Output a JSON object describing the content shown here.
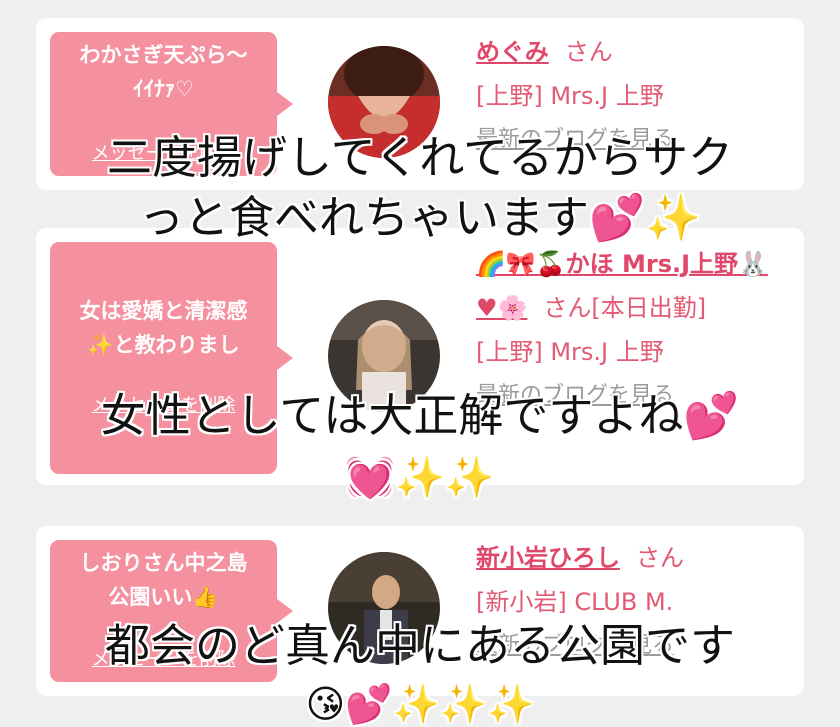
{
  "cards": [
    {
      "bubble_text": "わかさぎ天ぷら〜\nｲｲﾅｧ♡",
      "delete_label": "メッセージを削除",
      "name": "めぐみ",
      "honorific": "さん",
      "area": "[上野] Mrs.J 上野",
      "blog_link": "最新のブログを見る"
    },
    {
      "bubble_text": "女は愛嬌と清潔感\n✨と教わりまし",
      "delete_label": "メッセージを削除",
      "name": "🌈🎀🍒かほ Mrs.J上野🐰♥🌸",
      "honorific": "さん[本日出勤]",
      "area": "[上野] Mrs.J 上野",
      "blog_link": "最新のブログを見る"
    },
    {
      "bubble_text": "しおりさん中之島\n公園いい👍",
      "delete_label": "メッセージを削除",
      "name": "新小岩ひろし",
      "honorific": "さん",
      "area": "[新小岩] CLUB M.",
      "blog_link": "最新のブログを見る"
    }
  ],
  "captions": {
    "line1": "二度揚げしてくれてるからサク",
    "line2": "っと食べれちゃいます💕✨",
    "line3": "女性としては大正解ですよね💕",
    "line4": "💓✨✨",
    "line5": "都会のど真ん中にある公園です",
    "line6": "😘💕✨✨✨"
  },
  "colors": {
    "bubble": "#f5909f",
    "accent": "#e0486a",
    "background": "#efefef"
  },
  "icons": [
    "avatar-photo-1",
    "avatar-photo-2",
    "avatar-photo-3"
  ]
}
